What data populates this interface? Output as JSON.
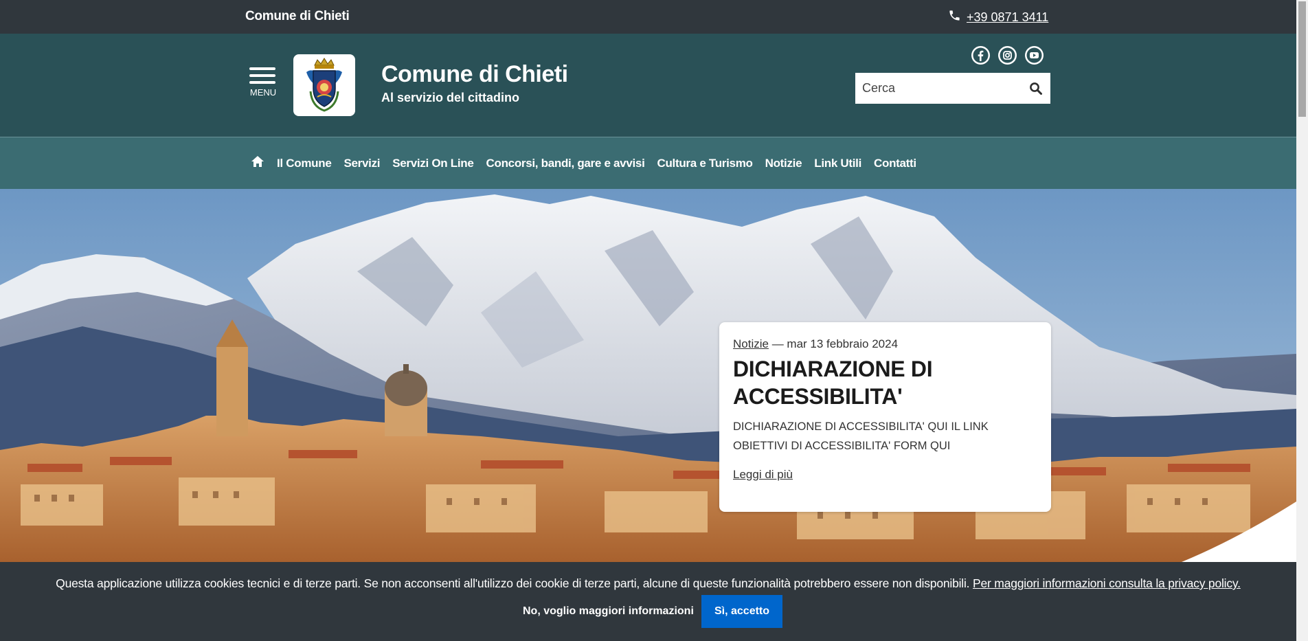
{
  "topbar": {
    "site_name": "Comune di Chieti",
    "phone": "+39 0871 3411"
  },
  "header": {
    "menu_label": "MENU",
    "title": "Comune di Chieti",
    "subtitle": "Al servizio del cittadino",
    "social_icons": [
      "facebook-icon",
      "instagram-icon",
      "youtube-icon"
    ],
    "search_placeholder": "Cerca"
  },
  "nav": {
    "items": [
      "Il Comune",
      "Servizi",
      "Servizi On Line",
      "Concorsi, bandi, gare e avvisi",
      "Cultura e Turismo",
      "Notizie",
      "Link Utili",
      "Contatti"
    ]
  },
  "hero_card": {
    "category": "Notizie",
    "date": " — mar 13 febbraio 2024",
    "title": "DICHIARAZIONE DI ACCESSIBILITA'",
    "body": "DICHIARAZIONE DI ACCESSIBILITA' QUI IL LINK  OBIETTIVI DI ACCESSIBILITA'  FORM  QUI",
    "more_label": "Leggi di più"
  },
  "cookie_bar": {
    "message": "Questa applicazione utilizza cookies tecnici e di terze parti. Se non acconsenti all'utilizzo dei cookie di terze parti, alcune di queste funzionalità potrebbero essere non disponibili. ",
    "link_label": "Per maggiori informazioni consulta la privacy policy.",
    "decline_label": "No, voglio maggiori informazioni",
    "accept_label": "Sì, accetto"
  },
  "colors": {
    "topbar_bg": "#30373d",
    "header_bg": "#2a5157",
    "nav_bg": "#3b6c72",
    "accent_blue": "#0066cc"
  }
}
